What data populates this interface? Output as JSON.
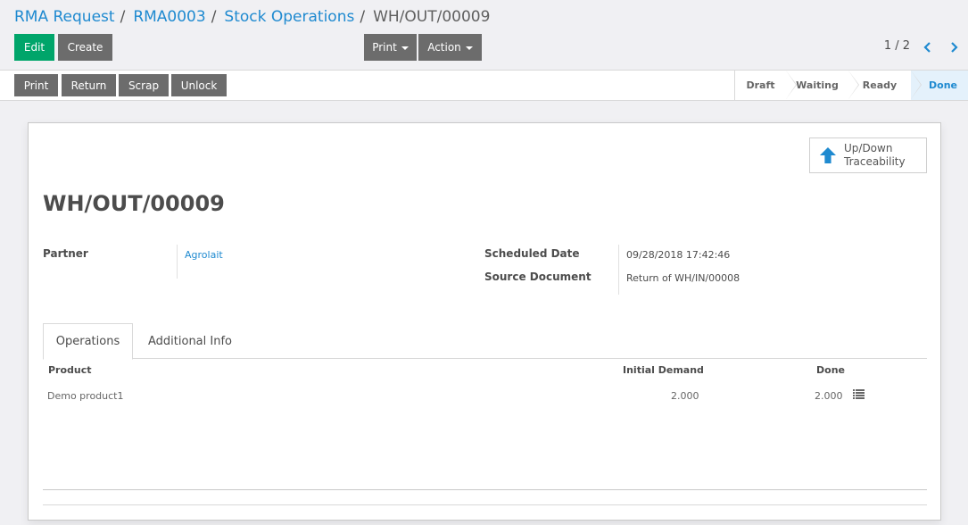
{
  "breadcrumb": {
    "items": [
      "RMA Request",
      "RMA0003",
      "Stock Operations"
    ],
    "current": "WH/OUT/00009",
    "separator": "/"
  },
  "toolbar": {
    "edit_label": "Edit",
    "create_label": "Create",
    "print_label": "Print",
    "action_label": "Action"
  },
  "pager": {
    "value": "1 / 2"
  },
  "statusbar": {
    "buttons": [
      "Print",
      "Return",
      "Scrap",
      "Unlock"
    ],
    "stages": [
      "Draft",
      "Waiting",
      "Ready",
      "Done"
    ],
    "active_stage": "Done"
  },
  "smart_button": {
    "line1": "Up/Down",
    "line2": "Traceability"
  },
  "record": {
    "title": "WH/OUT/00009",
    "partner_label": "Partner",
    "partner_value": "Agrolait",
    "scheduled_date_label": "Scheduled Date",
    "scheduled_date_value": "09/28/2018 17:42:46",
    "source_document_label": "Source Document",
    "source_document_value": "Return of WH/IN/00008"
  },
  "tabs": [
    "Operations",
    "Additional Info"
  ],
  "operations_table": {
    "headers": {
      "product": "Product",
      "initial_demand": "Initial Demand",
      "done": "Done"
    },
    "rows": [
      {
        "product": "Demo product1",
        "initial_demand": "2.000",
        "done": "2.000"
      }
    ]
  },
  "colors": {
    "primary": "#00a56a",
    "secondary": "#6c6c6c",
    "link": "#1f8ad0",
    "active_stage_bg": "#e4f1fb"
  }
}
